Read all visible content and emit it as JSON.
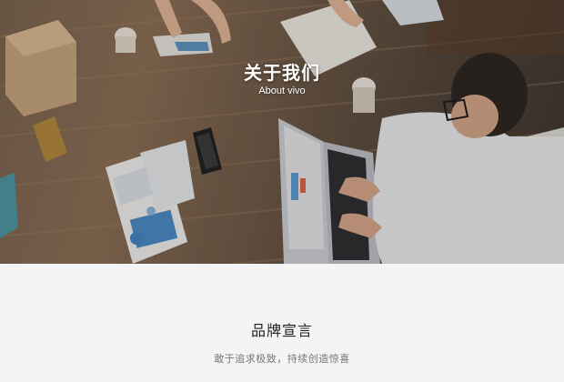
{
  "hero": {
    "title": "关于我们",
    "subtitle": "About vivo",
    "image": "office-meeting-overhead-photo"
  },
  "brand": {
    "heading": "品牌宣言",
    "slogan": "敢于追求极致，持续创造惊喜"
  },
  "colors": {
    "page_background": "#f4f4f4",
    "heading_text": "#222222",
    "slogan_text": "#777777",
    "hero_text": "#ffffff"
  }
}
